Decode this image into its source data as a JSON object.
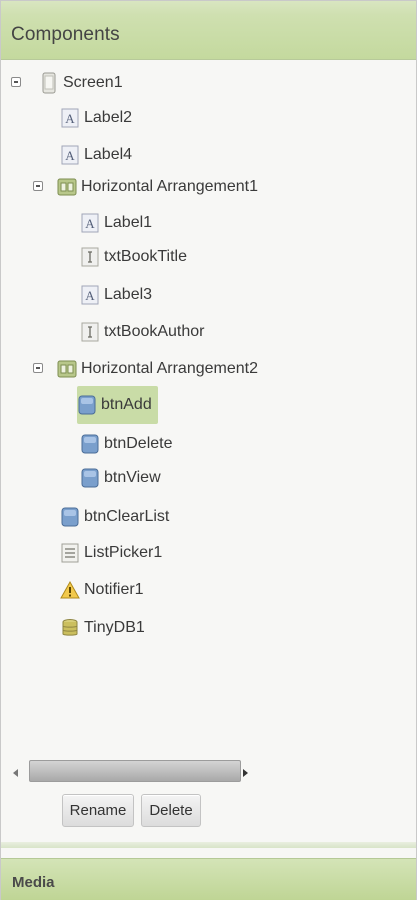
{
  "header": {
    "title": "Components"
  },
  "tree": [
    {
      "id": "screen1",
      "label": "Screen1",
      "icon": "screen-icon",
      "expandable": true
    },
    {
      "id": "label2",
      "label": "Label2",
      "icon": "label-icon"
    },
    {
      "id": "label4",
      "label": "Label4",
      "icon": "label-icon"
    },
    {
      "id": "harr1",
      "label": "Horizontal Arrangement1",
      "icon": "arrangement-icon",
      "expandable": true
    },
    {
      "id": "label1",
      "label": "Label1",
      "icon": "label-icon"
    },
    {
      "id": "txtbooktitle",
      "label": "txtBookTitle",
      "icon": "textbox-icon"
    },
    {
      "id": "label3",
      "label": "Label3",
      "icon": "label-icon"
    },
    {
      "id": "txtbookauthor",
      "label": "txtBookAuthor",
      "icon": "textbox-icon"
    },
    {
      "id": "harr2",
      "label": "Horizontal Arrangement2",
      "icon": "arrangement-icon",
      "expandable": true
    },
    {
      "id": "btnadd",
      "label": "btnAdd",
      "icon": "button-icon",
      "selected": true
    },
    {
      "id": "btndelete",
      "label": "btnDelete",
      "icon": "button-icon"
    },
    {
      "id": "btnview",
      "label": "btnView",
      "icon": "button-icon"
    },
    {
      "id": "btnclearlist",
      "label": "btnClearList",
      "icon": "button-icon"
    },
    {
      "id": "listpicker1",
      "label": "ListPicker1",
      "icon": "listpicker-icon"
    },
    {
      "id": "notifier1",
      "label": "Notifier1",
      "icon": "warning-icon"
    },
    {
      "id": "tinydb1",
      "label": "TinyDB1",
      "icon": "database-icon"
    }
  ],
  "actions": {
    "rename_label": "Rename",
    "delete_label": "Delete"
  },
  "media": {
    "title": "Media"
  },
  "colors": {
    "header_green": "#c4d99e",
    "selected_green": "#c9dca7"
  }
}
